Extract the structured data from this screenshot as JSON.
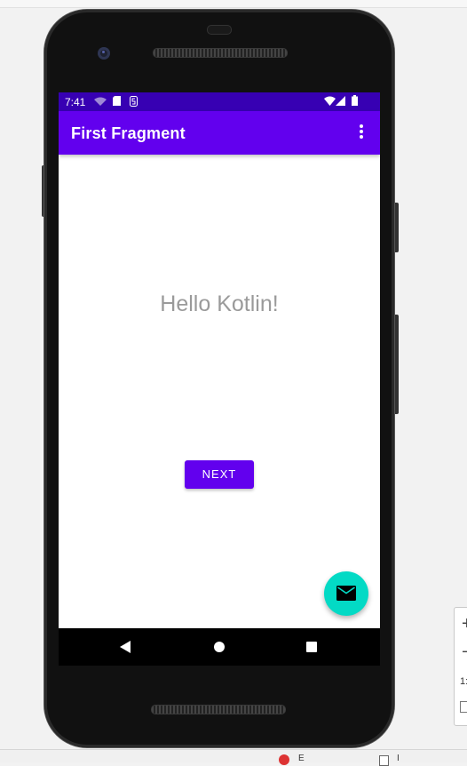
{
  "status_bar": {
    "time": "7:41"
  },
  "app_bar": {
    "title": "First Fragment"
  },
  "content": {
    "message": "Hello Kotlin!",
    "next_label": "NEXT"
  },
  "fab": {
    "icon": "email-icon",
    "color": "#03dac5"
  },
  "nav": {
    "back": "back-icon",
    "home": "home-icon",
    "recents": "recents-icon"
  },
  "side_panel": {
    "plus": "+",
    "minus": "−",
    "value": "1:"
  },
  "ide_bottom_bar": {
    "error_label": "E",
    "layout_label": "I"
  },
  "colors": {
    "status_bar": "#3700b3",
    "app_bar": "#6200ee",
    "accent": "#03dac5",
    "button": "#6200ee"
  }
}
